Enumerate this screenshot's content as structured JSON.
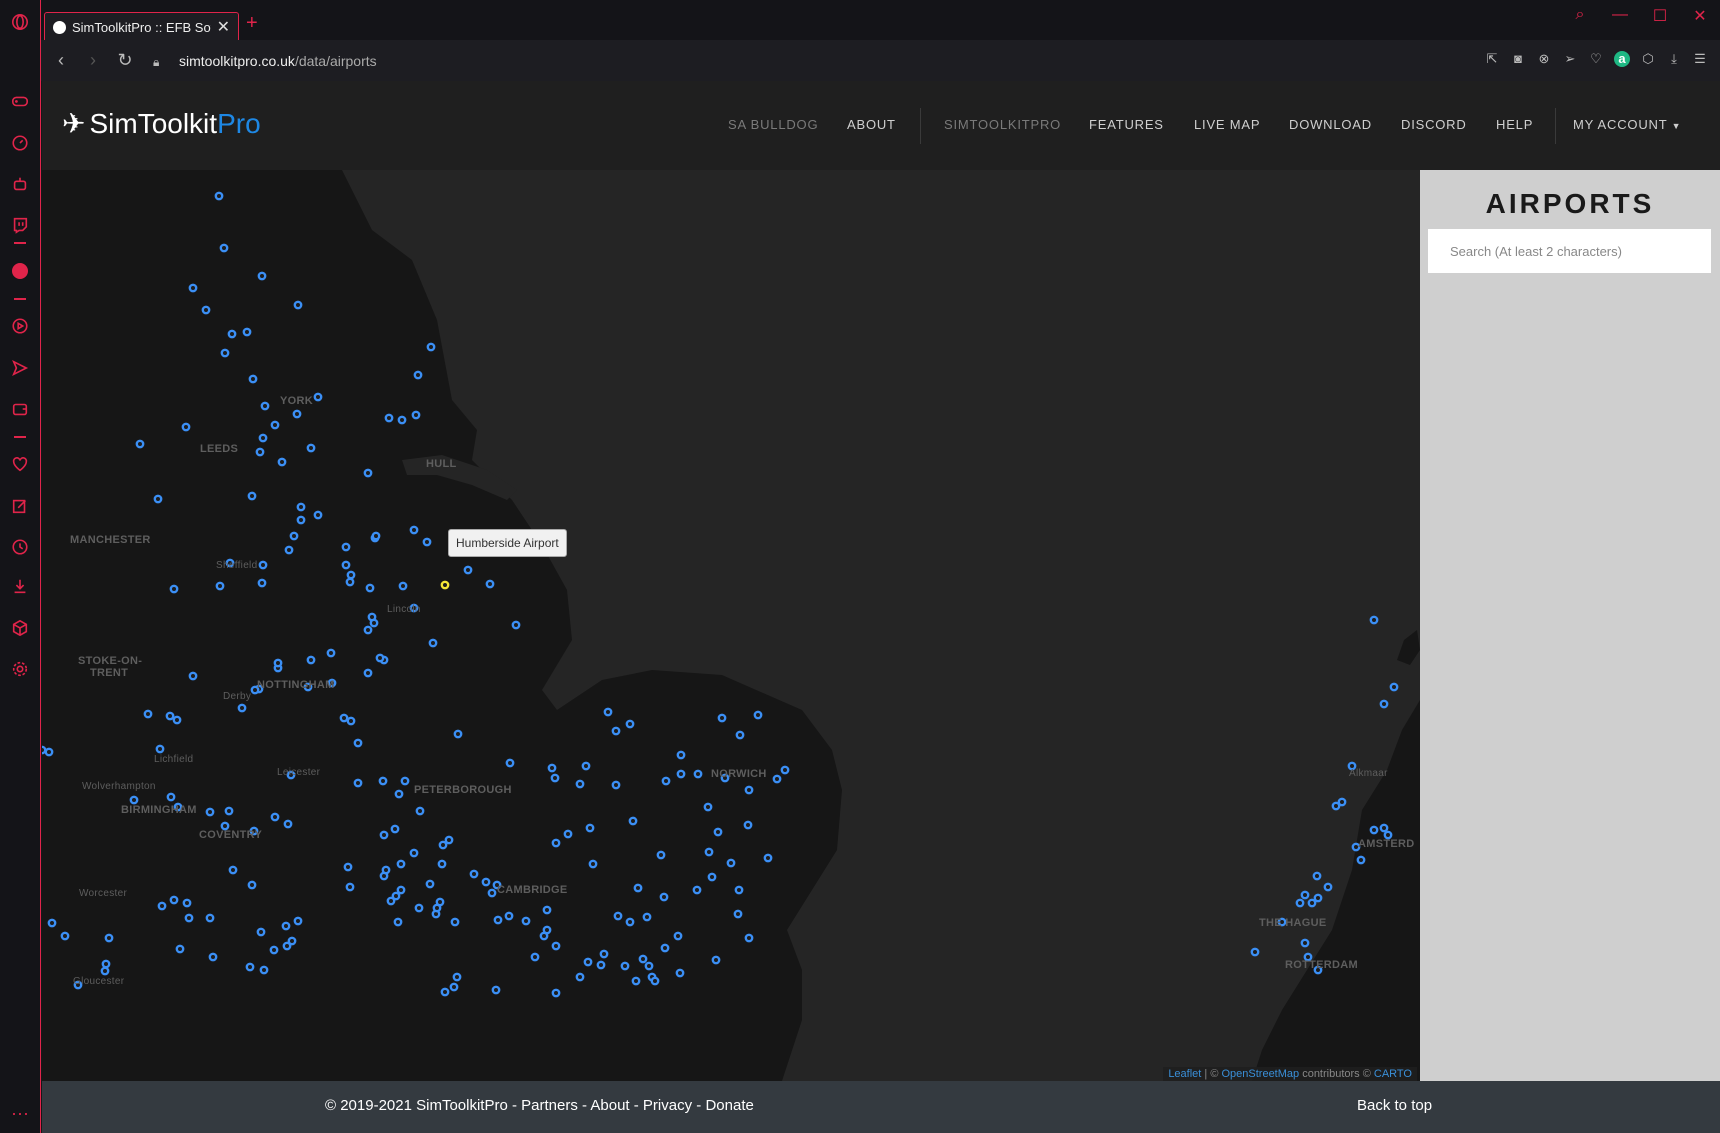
{
  "browser": {
    "tab_title": "SimToolkitPro :: EFB Softwa",
    "new_tab": "+",
    "url_host": "simtoolkitpro.co.uk",
    "url_path": "/data/airports",
    "accent": "#e0244a"
  },
  "site": {
    "logo_main": "SimToolkit",
    "logo_accent": "Pro",
    "menu": {
      "sa_bulldog": "SA BULLDOG",
      "about": "ABOUT",
      "simtoolkitpro": "SIMTOOLKITPRO",
      "features": "FEATURES",
      "live_map": "LIVE MAP",
      "download": "DOWNLOAD",
      "discord": "DISCORD",
      "help": "HELP",
      "my_account": "MY ACCOUNT"
    }
  },
  "map": {
    "labels": {
      "york": "YORK",
      "leeds": "LEEDS",
      "hull": "HULL",
      "manchester": "MANCHESTER",
      "sheffield": "Sheffield",
      "lincoln": "Lincoln",
      "stoke": "STOKE-ON-",
      "trent": "TRENT",
      "nottingham": "NOTTINGHAM",
      "derby": "Derby",
      "lichfield": "Lichfield",
      "wolverhampton": "Wolverhampton",
      "leicester": "Leicester",
      "peterborough": "PETERBOROUGH",
      "birmingham": "BIRMINGHAM",
      "coventry": "COVENTRY",
      "norwich": "NORWICH",
      "worcester": "Worcester",
      "cambridge": "CAMBRIDGE",
      "gloucester": "Gloucester",
      "alkmaar": "Alkmaar",
      "amsterdam": "AMSTERD",
      "the_hague": "THE HAGUE",
      "rotterdam": "ROTTERDAM"
    },
    "tooltip": "Humberside Airport",
    "attribution": {
      "leaflet": "Leaflet",
      "sep": " | © ",
      "osm": "OpenStreetMap",
      "contrib": " contributors © ",
      "carto": "CARTO"
    },
    "marker_color": "#3b8ff5",
    "selected_color": "#f5e637"
  },
  "panel": {
    "title": "AIRPORTS",
    "search_placeholder": "Search (At least 2 characters)"
  },
  "footer": {
    "copyright": "© 2019-2021 SimToolkitPro - ",
    "partners": "Partners",
    "d1": " - ",
    "about": "About",
    "d2": " - ",
    "privacy": "Privacy",
    "d3": " - ",
    "donate": "Donate",
    "back_to_top": "Back to top"
  }
}
